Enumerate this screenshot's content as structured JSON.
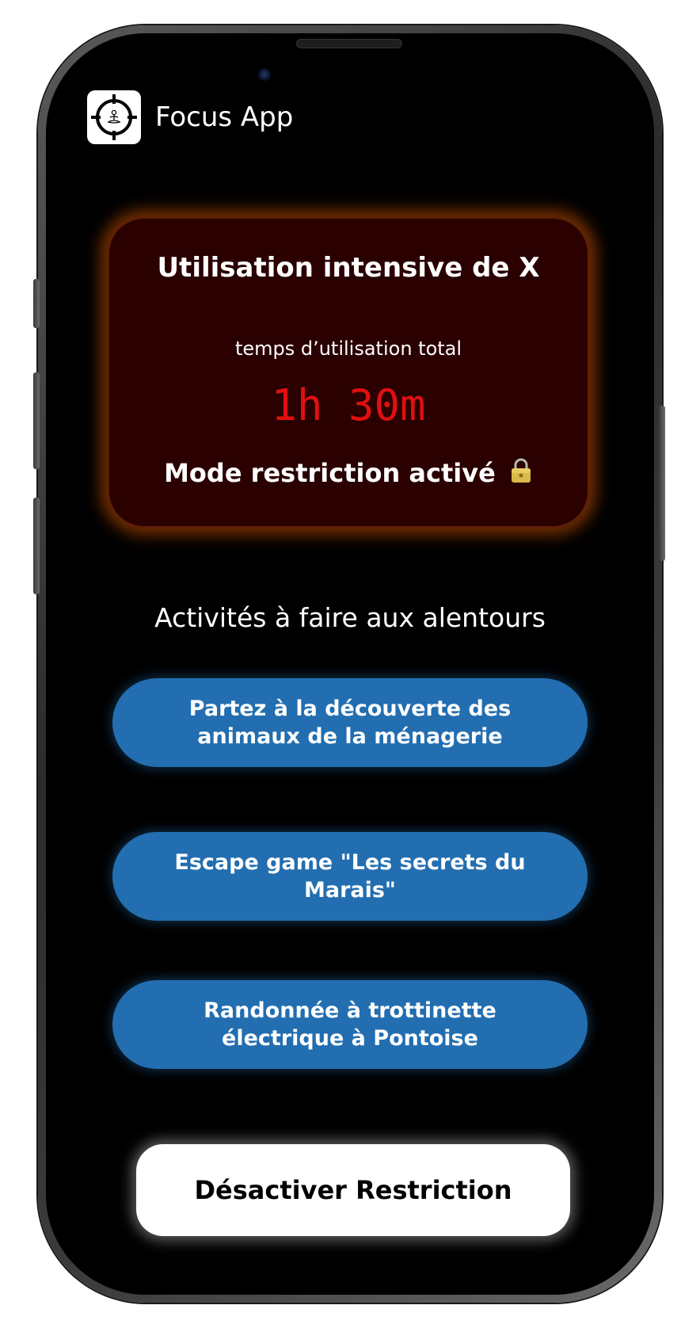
{
  "app": {
    "title": "Focus App",
    "logo_icon": "crosshair-meditation-icon"
  },
  "alert": {
    "title": "Utilisation intensive de X",
    "usage_label": "temps d’utilisation total",
    "usage_value": "1h 30m",
    "restriction_status": "Mode restriction activé",
    "status_icon": "lock-icon",
    "accent_color": "#e01010",
    "glow_color": "#c85000",
    "background_color": "#2a0000"
  },
  "activities": {
    "section_title": "Activités à faire aux alentours",
    "button_color": "#226eb0",
    "items": [
      {
        "label": "Partez à la découverte des animaux de la ménagerie"
      },
      {
        "label": "Escape game \"Les secrets du Marais\""
      },
      {
        "label": "Randonnée à trottinette électrique à Pontoise"
      }
    ]
  },
  "actions": {
    "disable_label": "Désactiver Restriction"
  }
}
